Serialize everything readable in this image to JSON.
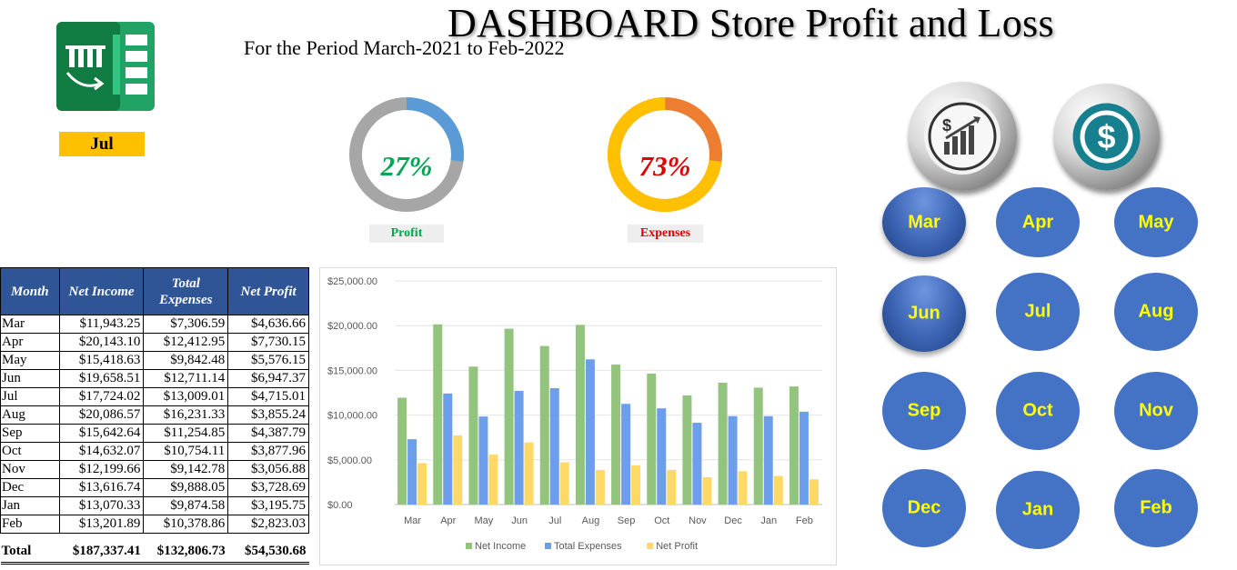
{
  "header": {
    "title": "DASHBOARD  Store Profit and Loss",
    "subtitle": "For the Period March-2021 to Feb-2022"
  },
  "selected_month": "Jul",
  "kpis": {
    "profit": {
      "percent": "27%",
      "label": "Profit",
      "fraction": 0.27,
      "color": "#5b9bd5",
      "track": "#a6a6a6"
    },
    "expenses": {
      "percent": "73%",
      "label": "Expenses",
      "fraction": 0.73,
      "color": "#ffc000",
      "track": "#ed7d31"
    }
  },
  "table": {
    "headers": [
      "Month",
      "Net Income",
      "Total Expenses",
      "Net Profit"
    ],
    "rows": [
      [
        "Mar",
        "$11,943.25",
        "$7,306.59",
        "$4,636.66"
      ],
      [
        "Apr",
        "$20,143.10",
        "$12,412.95",
        "$7,730.15"
      ],
      [
        "May",
        "$15,418.63",
        "$9,842.48",
        "$5,576.15"
      ],
      [
        "Jun",
        "$19,658.51",
        "$12,711.14",
        "$6,947.37"
      ],
      [
        "Jul",
        "$17,724.02",
        "$13,009.01",
        "$4,715.01"
      ],
      [
        "Aug",
        "$20,086.57",
        "$16,231.33",
        "$3,855.24"
      ],
      [
        "Sep",
        "$15,642.64",
        "$11,254.85",
        "$4,387.79"
      ],
      [
        "Oct",
        "$14,632.07",
        "$10,754.11",
        "$3,877.96"
      ],
      [
        "Nov",
        "$12,199.66",
        "$9,142.78",
        "$3,056.88"
      ],
      [
        "Dec",
        "$13,616.74",
        "$9,888.05",
        "$3,728.69"
      ],
      [
        "Jan",
        "$13,070.33",
        "$9,874.58",
        "$3,195.75"
      ],
      [
        "Feb",
        "$13,201.89",
        "$10,378.86",
        "$2,823.03"
      ]
    ],
    "total": [
      "Total",
      "$187,337.41",
      "$132,806.73",
      "$54,530.68"
    ]
  },
  "chart_data": {
    "type": "bar",
    "categories": [
      "Mar",
      "Apr",
      "May",
      "Jun",
      "Jul",
      "Aug",
      "Sep",
      "Oct",
      "Nov",
      "Dec",
      "Jan",
      "Feb"
    ],
    "series": [
      {
        "name": "Net Income",
        "color": "#93c47d",
        "values": [
          11943.25,
          20143.1,
          15418.63,
          19658.51,
          17724.02,
          20086.57,
          15642.64,
          14632.07,
          12199.66,
          13616.74,
          13070.33,
          13201.89
        ]
      },
      {
        "name": "Total Expenses",
        "color": "#6d9eeb",
        "values": [
          7306.59,
          12412.95,
          9842.48,
          12711.14,
          13009.01,
          16231.33,
          11254.85,
          10754.11,
          9142.78,
          9888.05,
          9874.58,
          10378.86
        ]
      },
      {
        "name": "Net Profit",
        "color": "#ffd966",
        "values": [
          4636.66,
          7730.15,
          5576.15,
          6947.37,
          4715.01,
          3855.24,
          4387.79,
          3877.96,
          3056.88,
          3728.69,
          3195.75,
          2823.03
        ]
      }
    ],
    "yticks": [
      "$0.00",
      "$5,000.00",
      "$10,000.00",
      "$15,000.00",
      "$20,000.00",
      "$25,000.00"
    ],
    "ylim": [
      0,
      25000
    ],
    "legend_position": "bottom",
    "grid": true
  },
  "buttons": {
    "months": [
      "Mar",
      "Apr",
      "May",
      "Jun",
      "Jul",
      "Aug",
      "Sep",
      "Oct",
      "Nov",
      "Dec",
      "Jan",
      "Feb"
    ],
    "icons": [
      "growth-chart-icon",
      "dollar-icon"
    ]
  }
}
